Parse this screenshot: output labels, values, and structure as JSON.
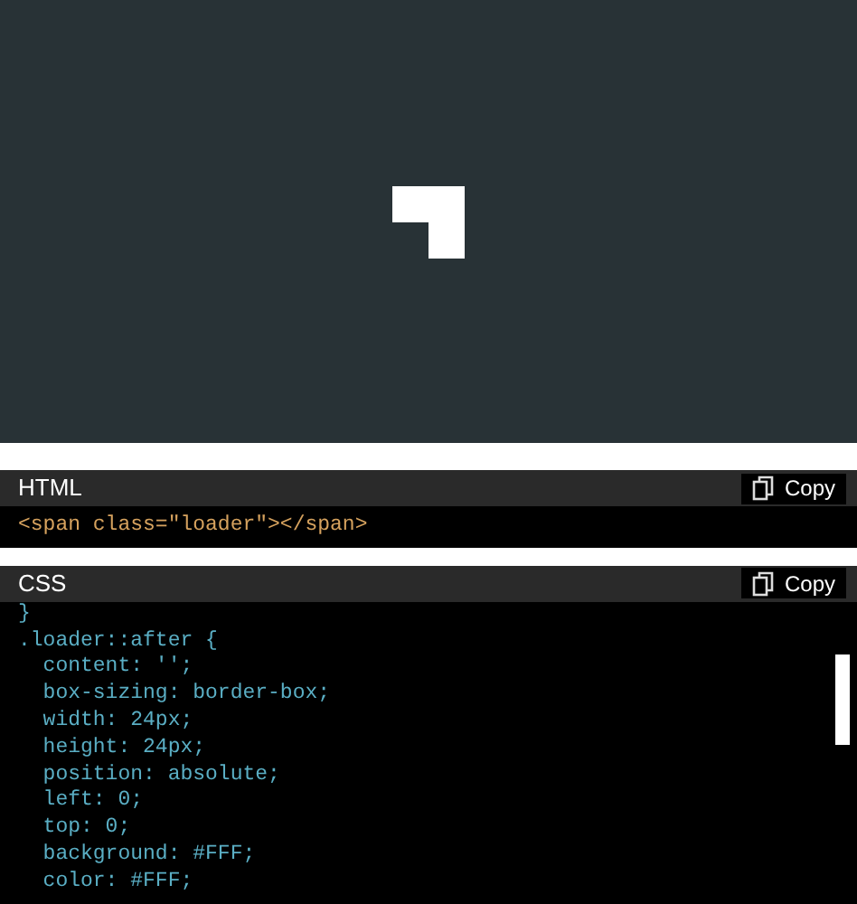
{
  "panels": [
    {
      "title": "HTML",
      "copy_label": "Copy",
      "kind": "html",
      "lines": [
        "<span class=\"loader\"></span>"
      ]
    },
    {
      "title": "CSS",
      "copy_label": "Copy",
      "kind": "css",
      "lines": [
        "}",
        ".loader::after {",
        "  content: '';",
        "  box-sizing: border-box;",
        "  width: 24px;",
        "  height: 24px;",
        "  position: absolute;",
        "  left: 0;",
        "  top: 0;",
        "  background: #FFF;",
        "  color: #FFF;"
      ]
    }
  ]
}
